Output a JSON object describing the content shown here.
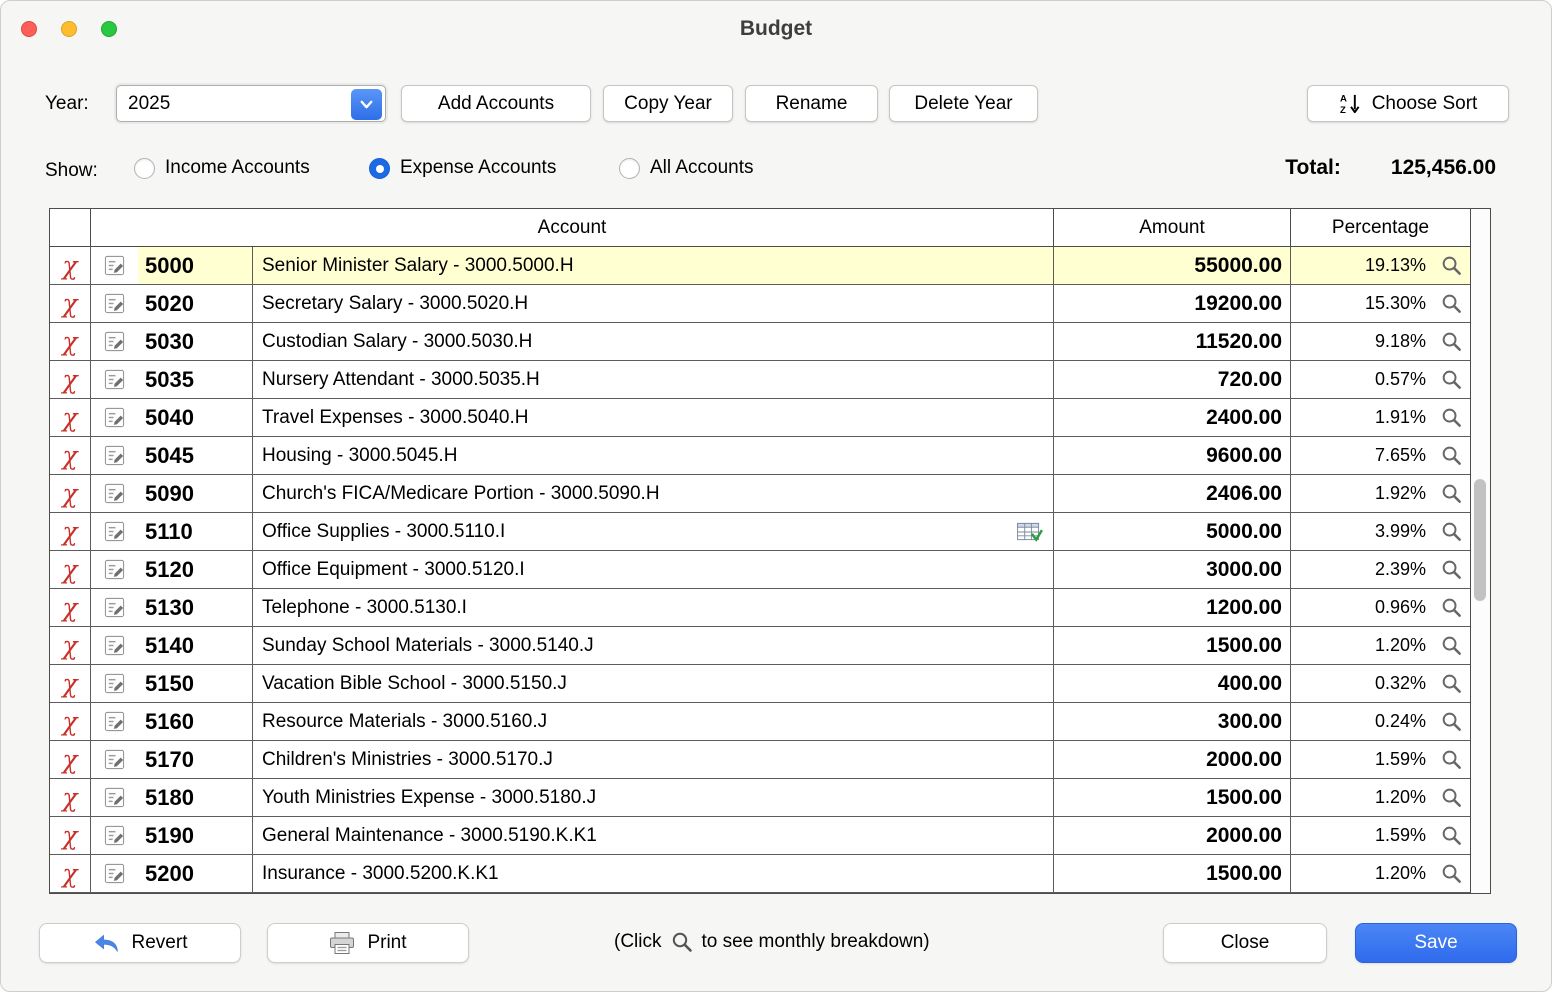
{
  "window": {
    "title": "Budget"
  },
  "toolbar": {
    "year_label": "Year:",
    "year_value": "2025",
    "add_accounts": "Add Accounts",
    "copy_year": "Copy Year",
    "rename": "Rename",
    "delete_year": "Delete Year",
    "choose_sort": "Choose Sort"
  },
  "filters": {
    "show_label": "Show:",
    "options": [
      {
        "label": "Income Accounts",
        "selected": false
      },
      {
        "label": "Expense Accounts",
        "selected": true
      },
      {
        "label": "All Accounts",
        "selected": false
      }
    ],
    "total_label": "Total:",
    "total_value": "125,456.00"
  },
  "table": {
    "headers": {
      "account": "Account",
      "amount": "Amount",
      "percentage": "Percentage"
    },
    "rows": [
      {
        "number": "5000",
        "name": "Senior Minister Salary - 3000.5000.H",
        "amount": "55000.00",
        "percentage": "19.13%",
        "selected": true
      },
      {
        "number": "5020",
        "name": "Secretary Salary - 3000.5020.H",
        "amount": "19200.00",
        "percentage": "15.30%"
      },
      {
        "number": "5030",
        "name": "Custodian Salary - 3000.5030.H",
        "amount": "11520.00",
        "percentage": "9.18%"
      },
      {
        "number": "5035",
        "name": "Nursery Attendant - 3000.5035.H",
        "amount": "720.00",
        "percentage": "0.57%"
      },
      {
        "number": "5040",
        "name": "Travel Expenses - 3000.5040.H",
        "amount": "2400.00",
        "percentage": "1.91%"
      },
      {
        "number": "5045",
        "name": "Housing - 3000.5045.H",
        "amount": "9600.00",
        "percentage": "7.65%"
      },
      {
        "number": "5090",
        "name": "Church's FICA/Medicare Portion - 3000.5090.H",
        "amount": "2406.00",
        "percentage": "1.92%"
      },
      {
        "number": "5110",
        "name": "Office Supplies - 3000.5110.I",
        "amount": "5000.00",
        "percentage": "3.99%",
        "has_grid_icon": true
      },
      {
        "number": "5120",
        "name": "Office Equipment - 3000.5120.I",
        "amount": "3000.00",
        "percentage": "2.39%"
      },
      {
        "number": "5130",
        "name": "Telephone - 3000.5130.I",
        "amount": "1200.00",
        "percentage": "0.96%"
      },
      {
        "number": "5140",
        "name": "Sunday School Materials - 3000.5140.J",
        "amount": "1500.00",
        "percentage": "1.20%"
      },
      {
        "number": "5150",
        "name": "Vacation Bible School - 3000.5150.J",
        "amount": "400.00",
        "percentage": "0.32%"
      },
      {
        "number": "5160",
        "name": "Resource Materials - 3000.5160.J",
        "amount": "300.00",
        "percentage": "0.24%"
      },
      {
        "number": "5170",
        "name": "Children's Ministries - 3000.5170.J",
        "amount": "2000.00",
        "percentage": "1.59%"
      },
      {
        "number": "5180",
        "name": "Youth Ministries Expense - 3000.5180.J",
        "amount": "1500.00",
        "percentage": "1.20%"
      },
      {
        "number": "5190",
        "name": "General Maintenance - 3000.5190.K.K1",
        "amount": "2000.00",
        "percentage": "1.59%"
      },
      {
        "number": "5200",
        "name": "Insurance - 3000.5200.K.K1",
        "amount": "1500.00",
        "percentage": "1.20%"
      }
    ]
  },
  "footer": {
    "revert": "Revert",
    "print": "Print",
    "hint_before": "(Click",
    "hint_after": "to see monthly breakdown)",
    "close": "Close",
    "save": "Save"
  },
  "icons": {
    "delete_x": "χ"
  },
  "colors": {
    "accent_blue": "#3174f0",
    "selected_row": "#ffffd2",
    "delete_red": "#c9302a",
    "traffic_red": "#ff5f57",
    "traffic_yellow": "#febc2e",
    "traffic_green": "#28c840"
  }
}
